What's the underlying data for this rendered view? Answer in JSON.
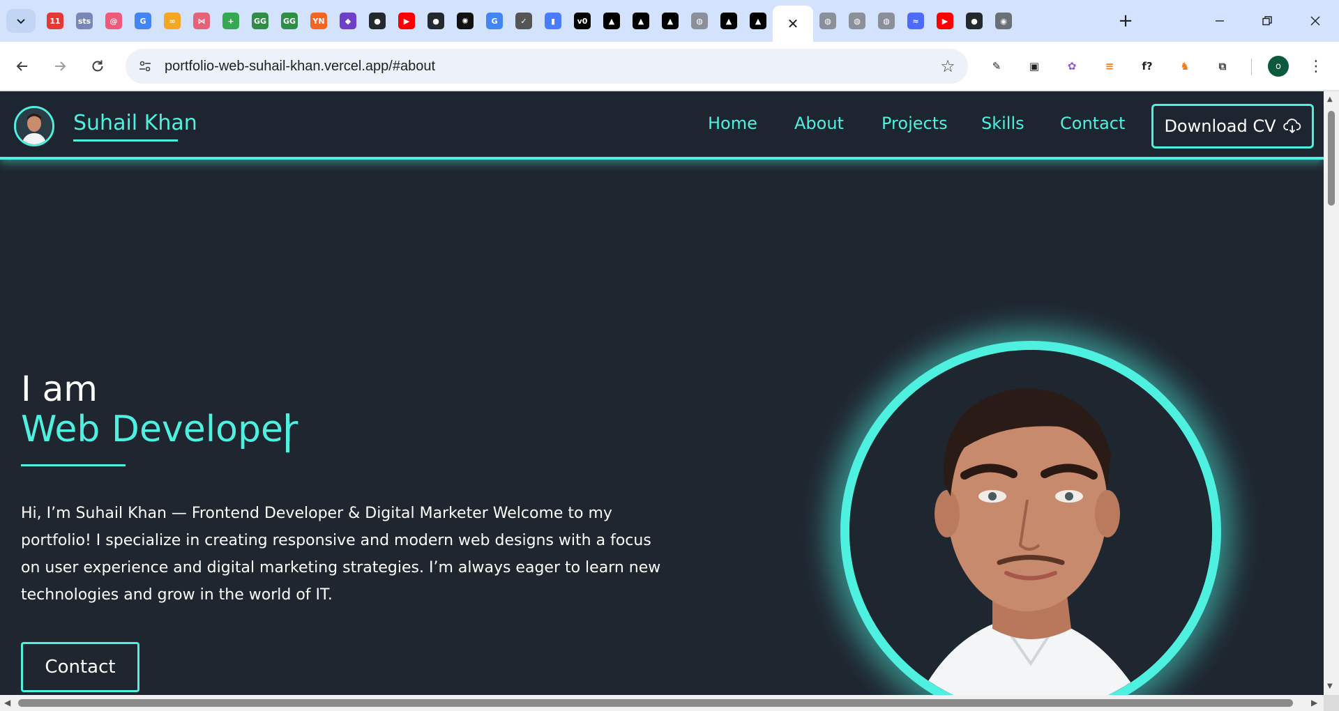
{
  "browser": {
    "tabs": [
      {
        "icon": "calendar-icon",
        "text": "11",
        "color": "#e53935"
      },
      {
        "icon": "site-icon",
        "text": "sts",
        "color": "#7a86b8"
      },
      {
        "icon": "spiral-icon",
        "text": "@",
        "color": "#ef5a7a"
      },
      {
        "icon": "google-g-icon",
        "text": "G",
        "color": "#4285f4"
      },
      {
        "icon": "infinity-icon",
        "text": "∞",
        "color": "#f5a623"
      },
      {
        "icon": "share-icon",
        "text": "⋈",
        "color": "#e5637a"
      },
      {
        "icon": "plus-square-icon",
        "text": "+",
        "color": "#34a853"
      },
      {
        "icon": "gfg-icon",
        "text": "GG",
        "color": "#2f8d46"
      },
      {
        "icon": "gfg-icon",
        "text": "GG",
        "color": "#2f8d46"
      },
      {
        "icon": "ycombinator-icon",
        "text": "YN",
        "color": "#f26522"
      },
      {
        "icon": "cat-icon",
        "text": "◆",
        "color": "#6e40c9"
      },
      {
        "icon": "github-icon",
        "text": "●",
        "color": "#24292f"
      },
      {
        "icon": "youtube-icon",
        "text": "▶",
        "color": "#ff0000"
      },
      {
        "icon": "github-icon",
        "text": "●",
        "color": "#24292f"
      },
      {
        "icon": "openai-icon",
        "text": "✺",
        "color": "#111111"
      },
      {
        "icon": "google-g-icon",
        "text": "G",
        "color": "#4285f4"
      },
      {
        "icon": "checkmark-icon",
        "text": "✓",
        "color": "#555555"
      },
      {
        "icon": "pill-icon",
        "text": "▮",
        "color": "#4a7cff"
      },
      {
        "icon": "v0-icon",
        "text": "v0",
        "color": "#000000"
      },
      {
        "icon": "vercel-icon",
        "text": "▲",
        "color": "#000000"
      },
      {
        "icon": "vercel-icon",
        "text": "▲",
        "color": "#000000"
      },
      {
        "icon": "vercel-icon",
        "text": "▲",
        "color": "#000000"
      },
      {
        "icon": "globe-icon",
        "text": "◍",
        "color": "#8a8f99"
      },
      {
        "icon": "vercel-icon",
        "text": "▲",
        "color": "#000000"
      },
      {
        "icon": "vercel-icon",
        "text": "▲",
        "color": "#000000"
      }
    ],
    "active_tab_close": "✕",
    "tabs_after": [
      {
        "icon": "globe-icon",
        "text": "◍",
        "color": "#8a8f99"
      },
      {
        "icon": "globe-icon",
        "text": "◍",
        "color": "#8a8f99"
      },
      {
        "icon": "globe-icon",
        "text": "◍",
        "color": "#8a8f99"
      },
      {
        "icon": "deepseek-icon",
        "text": "≈",
        "color": "#4d6bfe"
      },
      {
        "icon": "youtube-icon",
        "text": "▶",
        "color": "#ff0000"
      },
      {
        "icon": "github-icon",
        "text": "●",
        "color": "#24292f"
      },
      {
        "icon": "chrome-icon",
        "text": "◉",
        "color": "#6b6f76"
      }
    ],
    "new_tab": "+",
    "url": "portfolio-web-suhail-khan.vercel.app/#about",
    "profile_initial": "o",
    "extensions": [
      {
        "icon": "eyedropper-icon",
        "text": "✎",
        "color": "#202124"
      },
      {
        "icon": "image-icon",
        "text": "▣",
        "color": "#202124"
      },
      {
        "icon": "brain-icon",
        "text": "✿",
        "color": "#8e5bd6"
      },
      {
        "icon": "notes-icon",
        "text": "≡",
        "color": "#f07a1a"
      },
      {
        "icon": "formula-icon",
        "text": "f?",
        "color": "#202124"
      },
      {
        "icon": "fox-icon",
        "text": "♞",
        "color": "#f07a1a"
      },
      {
        "icon": "puzzle-icon",
        "text": "⧉",
        "color": "#3c4043"
      }
    ]
  },
  "site": {
    "brand": "Suhail Khan",
    "nav": [
      "Home",
      "About",
      "Projects",
      "Skills",
      "Contact"
    ],
    "cta": "Download CV",
    "accent": "#4ef0e0",
    "background": "#1f2630",
    "hero": {
      "intro": "I am",
      "role": "Web Developer",
      "bio": "Hi, I’m Suhail Khan — Frontend Developer & Digital Marketer Welcome to my portfolio! I specialize in creating responsive and modern web designs with a focus on user experience and digital marketing strategies. I’m always eager to learn new technologies and grow in the world of IT.",
      "button": "Contact"
    }
  }
}
